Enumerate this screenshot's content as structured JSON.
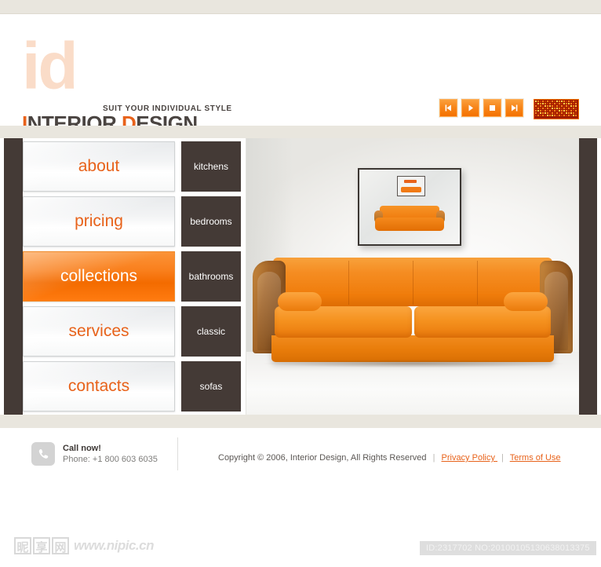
{
  "header": {
    "logo_mark": "id",
    "tagline": "SUIT YOUR INDIVIDUAL STYLE",
    "brand_first": "I",
    "brand_rest": "NTERIOR ",
    "brand_accent2": "D",
    "brand_rest2": "ESIGN"
  },
  "media_controls": {
    "buttons": [
      {
        "name": "previous-button",
        "glyph": "prev"
      },
      {
        "name": "play-button",
        "glyph": "play"
      },
      {
        "name": "stop-button",
        "glyph": "stop"
      },
      {
        "name": "next-button",
        "glyph": "next"
      }
    ],
    "equalizer_label": "led-matrix-display"
  },
  "main_nav": {
    "items": [
      {
        "label": "about",
        "active": false
      },
      {
        "label": "pricing",
        "active": false
      },
      {
        "label": "collections",
        "active": true
      },
      {
        "label": "services",
        "active": false
      },
      {
        "label": "contacts",
        "active": false
      }
    ]
  },
  "sub_nav": {
    "items": [
      {
        "label": "kitchens"
      },
      {
        "label": "bedrooms"
      },
      {
        "label": "bathrooms"
      },
      {
        "label": "classic"
      },
      {
        "label": "sofas"
      }
    ]
  },
  "hero": {
    "alt": "orange chesterfield sofa in white room with framed picture"
  },
  "footer": {
    "call_title": "Call now!",
    "call_phone": "Phone:  +1 800 603 6035",
    "copyright": "Copyright © 2006, Interior Design, All Rights Reserved",
    "sep1": "|",
    "privacy_link": "Privacy Policy ",
    "sep2": "|",
    "terms_link": "Terms of Use "
  },
  "watermark": {
    "cn_chars": [
      "昵",
      "享",
      "网"
    ],
    "url": "www.nipic.cn",
    "id_text": "ID:2317702 NO:20100105130638013375"
  },
  "colors": {
    "accent_orange": "#e8621a",
    "button_orange": "#f47200",
    "dark_panel": "#443a36",
    "beige_band": "#e9e6de",
    "logo_light": "#fadcc8"
  }
}
